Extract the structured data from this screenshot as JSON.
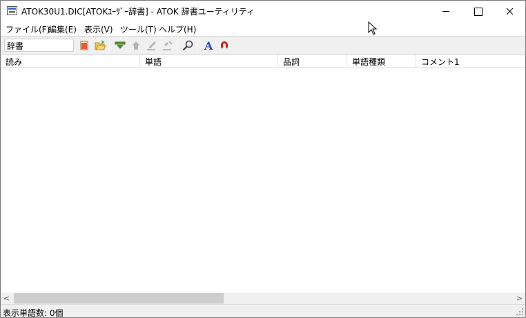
{
  "window": {
    "title": "ATOK30U1.DIC[ATOKﾕｰｻﾞｰ辞書] - ATOK 辞書ユーティリティ"
  },
  "menu": {
    "items": [
      {
        "label": "ファイル(F)"
      },
      {
        "label": "編集(E)"
      },
      {
        "label": "表示(V)"
      },
      {
        "label": "ツール(T)"
      },
      {
        "label": "ヘルプ(H)"
      }
    ]
  },
  "toolbar": {
    "dictionary_select": "辞書",
    "icons": [
      "new-dictionary-icon",
      "open-folder-icon",
      "register-word-icon",
      "up-icon",
      "edit-icon",
      "delete-icon",
      "search-icon",
      "font-icon",
      "magnet-icon"
    ]
  },
  "table": {
    "columns": [
      "読み",
      "単語",
      "品詞",
      "単語種類",
      "コメント1"
    ],
    "rows": []
  },
  "statusbar": {
    "text": "表示単語数: 0個"
  },
  "scrollbar": {
    "left_arrow": "<",
    "right_arrow": ">"
  }
}
